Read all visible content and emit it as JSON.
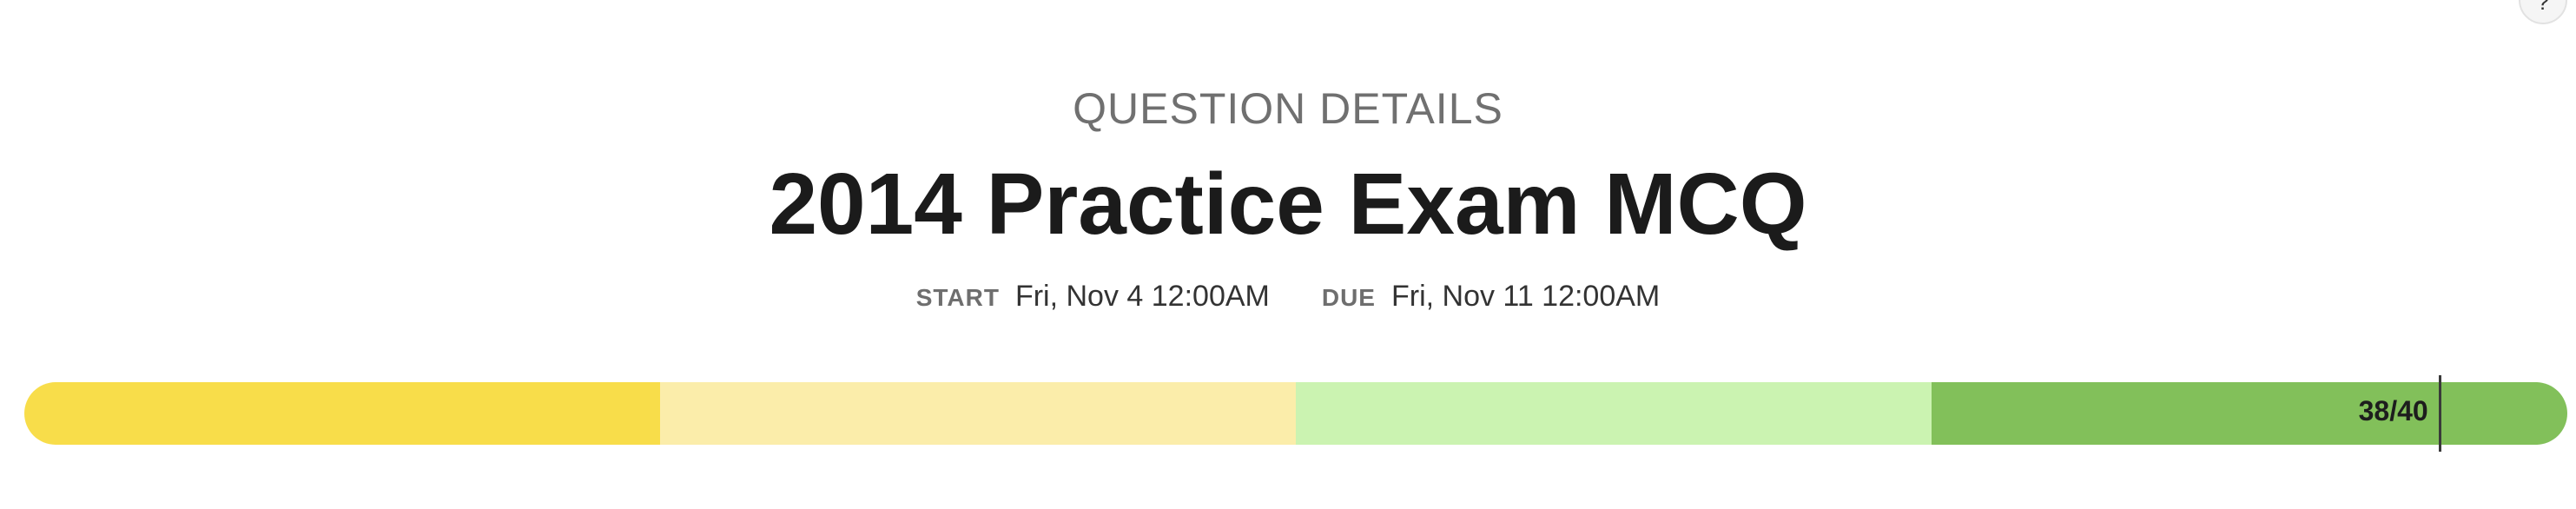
{
  "help_button": {
    "label": "?"
  },
  "header": {
    "subheading": "QUESTION DETAILS",
    "title": "2014 Practice Exam MCQ"
  },
  "dates": {
    "start": {
      "label": "START",
      "value": "Fri, Nov 4 12:00AM"
    },
    "due": {
      "label": "DUE",
      "value": "Fri, Nov 11 12:00AM"
    }
  },
  "score_bar": {
    "score_text": "38/40",
    "score": 38,
    "max": 40,
    "segment_colors": [
      "#f8dd4a",
      "#fbedaa",
      "#cbf3b1",
      "#82c05a"
    ],
    "marker_color": "#3a3a3a"
  }
}
